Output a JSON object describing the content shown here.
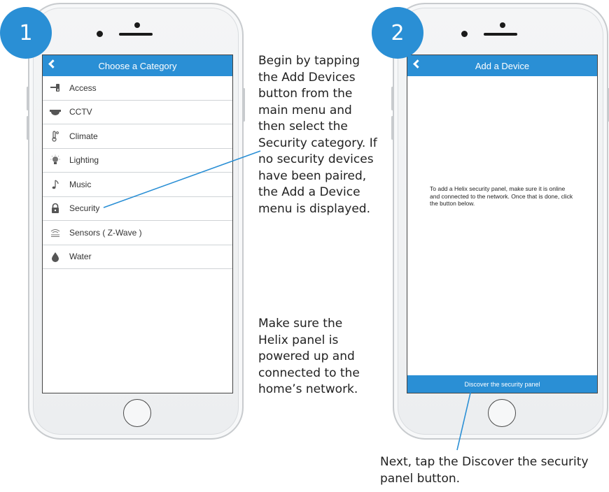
{
  "steps": [
    {
      "number": "1"
    },
    {
      "number": "2"
    }
  ],
  "screen1": {
    "title": "Choose a Category",
    "categories": [
      {
        "label": "Access",
        "icon": "door-lock-icon"
      },
      {
        "label": "CCTV",
        "icon": "camera-dome-icon"
      },
      {
        "label": "Climate",
        "icon": "thermometer-icon"
      },
      {
        "label": "Lighting",
        "icon": "lightbulb-icon"
      },
      {
        "label": "Music",
        "icon": "music-note-icon"
      },
      {
        "label": "Security",
        "icon": "padlock-icon"
      },
      {
        "label": "Sensors ( Z-Wave )",
        "icon": "wave-sensor-icon"
      },
      {
        "label": "Water",
        "icon": "water-drop-icon"
      }
    ]
  },
  "screen2": {
    "title": "Add a Device",
    "info": "To add a Helix security panel, make sure it is online and connected to the network. Once that is done, click the button below.",
    "button": "Discover the security panel"
  },
  "notes": {
    "top_lines": [
      "Begin by tapping",
      "the Add Devices",
      "button from the",
      "main menu and",
      "then select the",
      "Security category. If",
      "no security devices",
      "have been paired,",
      "the Add a Device",
      "menu is displayed."
    ],
    "middle_lines": [
      "Make sure the",
      "Helix panel is",
      "powered up and",
      "connected to the",
      "home’s network."
    ],
    "bottom_lines": [
      "Next, tap the Discover the security",
      "panel button."
    ]
  },
  "colors": {
    "accent": "#2a8fd5",
    "leader_line": "#2a8fd5"
  }
}
